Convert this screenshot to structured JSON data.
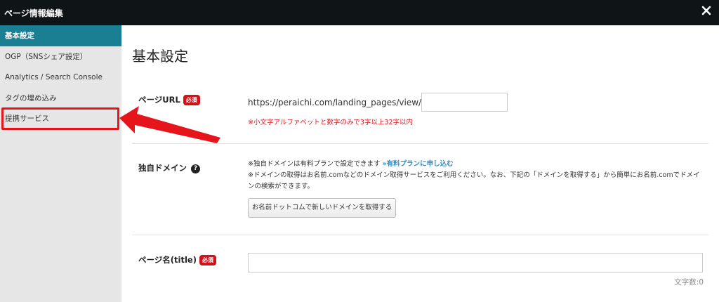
{
  "window": {
    "title": "ページ情報編集"
  },
  "sidebar": {
    "items": [
      {
        "label": "基本設定"
      },
      {
        "label": "OGP（SNSシェア設定）"
      },
      {
        "label": "Analytics / Search Console"
      },
      {
        "label": "タグの埋め込み"
      },
      {
        "label": "提携サービス"
      }
    ]
  },
  "main": {
    "heading": "基本設定",
    "required_badge": "必須",
    "page_url": {
      "label": "ページURL",
      "prefix": "https://peraichi.com/landing_pages/view/",
      "value": "",
      "note": "※小文字アルファベットと数字のみで3字以上32字以内"
    },
    "domain": {
      "label": "独自ドメイン",
      "help_icon": "?",
      "line1": "※独自ドメインは有料プランで設定できます ",
      "link": "»有料プランに申し込む",
      "line2": "※ドメインの取得はお名前.comなどのドメイン取得サービスをご利用ください。なお、下記の「ドメインを取得する」から簡単にお名前.comでドメインの検索ができます。",
      "button": "お名前ドットコムで新しいドメインを取得する"
    },
    "page_title": {
      "label": "ページ名(title)",
      "value": "",
      "char_count": "文字数:0"
    }
  },
  "colors": {
    "titlebar_bg": "#0f1417",
    "active_item_bg": "#1b7f93",
    "required_badge": "#d0121b",
    "annotation_red": "#e6151c",
    "link": "#2a8ec8"
  }
}
